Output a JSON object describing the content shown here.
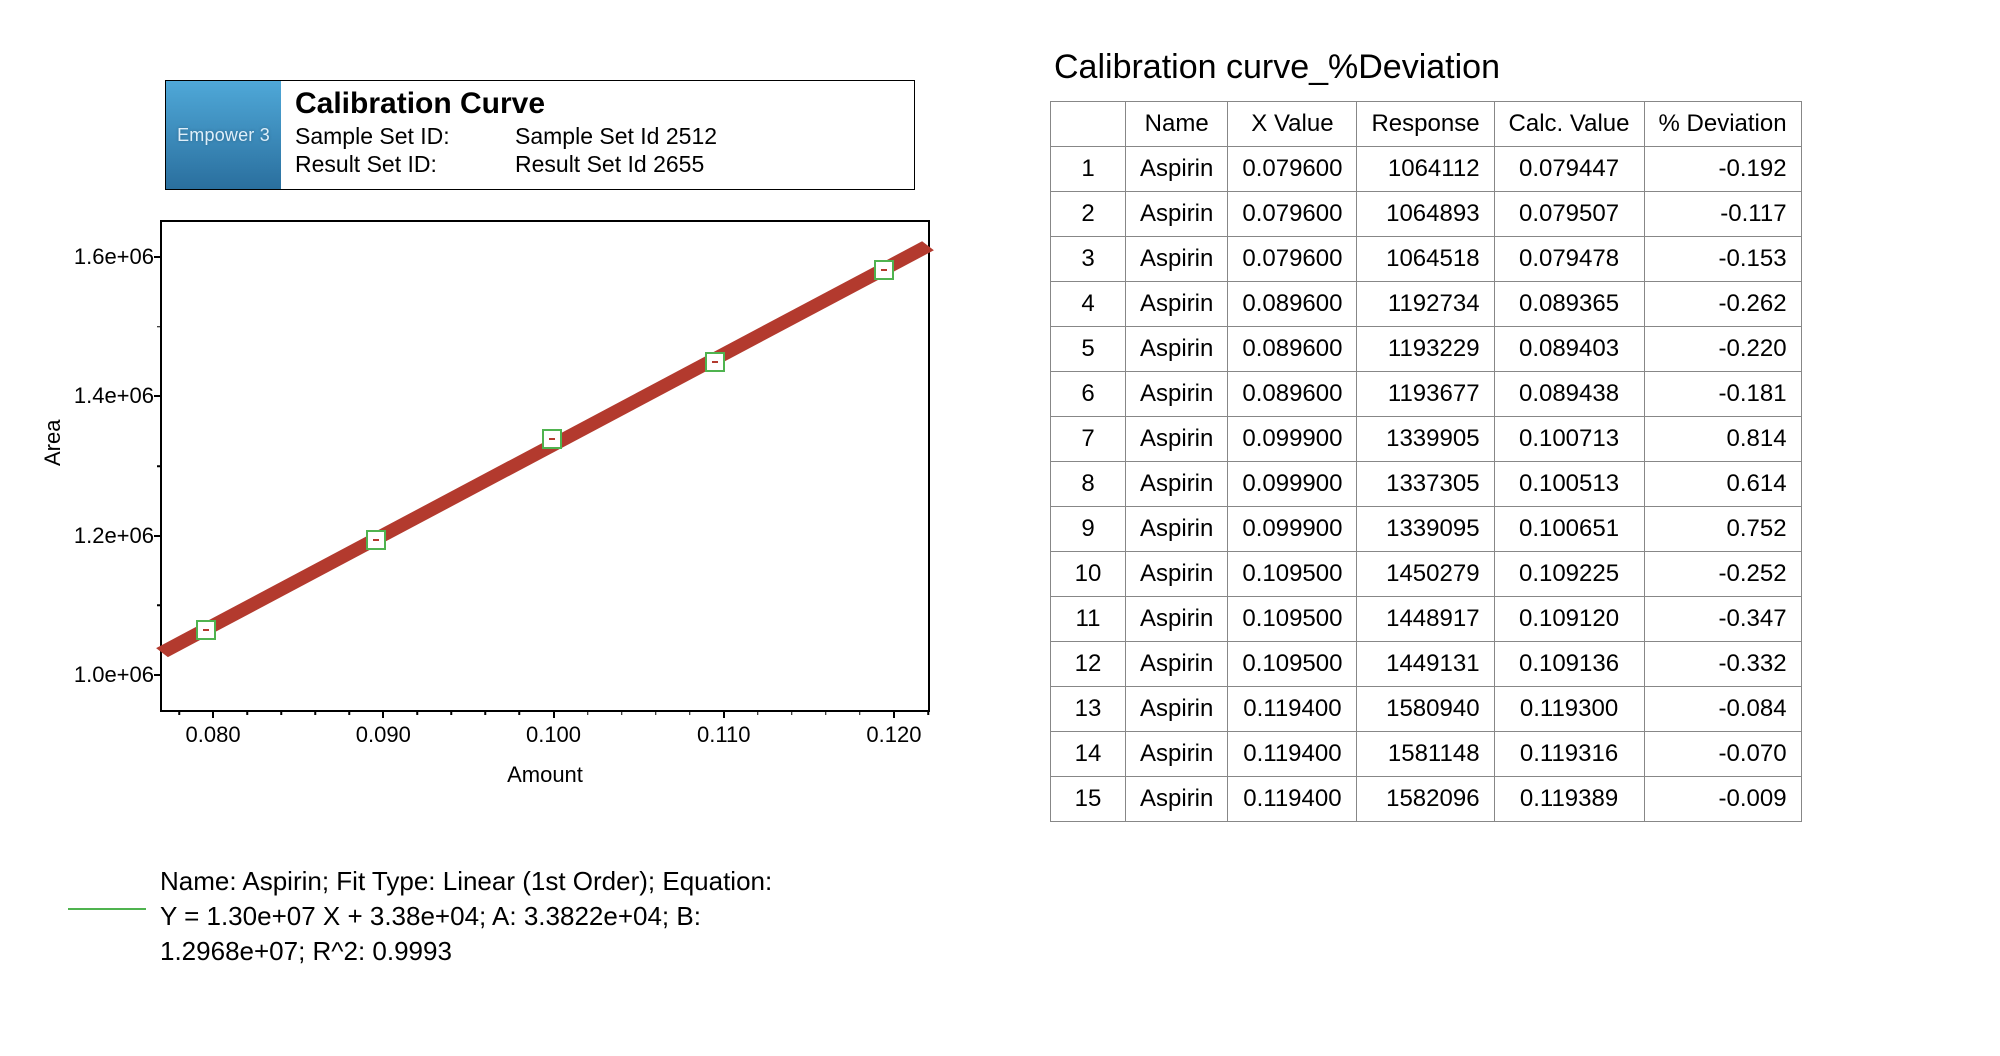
{
  "header": {
    "logo_text": "Empower 3",
    "title": "Calibration Curve",
    "sample_set_label": "Sample Set ID:",
    "sample_set_value": "Sample Set Id 2512",
    "result_set_label": "Result Set ID:",
    "result_set_value": "Result Set Id 2655"
  },
  "chart_data": {
    "type": "scatter",
    "title": "",
    "xlabel": "Amount",
    "ylabel": "Area",
    "xlim": [
      0.077,
      0.122
    ],
    "ylim": [
      950000,
      1650000
    ],
    "x_ticks": [
      0.08,
      0.09,
      0.1,
      0.11,
      0.12
    ],
    "x_tick_labels": [
      "0.080",
      "0.090",
      "0.100",
      "0.110",
      "0.120"
    ],
    "y_ticks": [
      1000000,
      1200000,
      1400000,
      1600000
    ],
    "y_tick_labels": [
      "1.0e+06",
      "1.2e+06",
      "1.4e+06",
      "1.6e+06"
    ],
    "series": [
      {
        "name": "Aspirin",
        "x": [
          0.0796,
          0.0896,
          0.0999,
          0.1095,
          0.1194
        ],
        "y": [
          1064500,
          1193200,
          1338800,
          1449400,
          1581400
        ],
        "fit": "linear",
        "fit_slope": 12968000,
        "fit_intercept": 33822
      }
    ],
    "x_minor_interval": 0.002,
    "y_minor_interval": 100000
  },
  "caption": {
    "line1": "Name: Aspirin;   Fit Type: Linear (1st Order); Equation:",
    "line2": "Y = 1.30e+07 X + 3.38e+04;   A: 3.3822e+04;   B:",
    "line3": "1.2968e+07;   R^2: 0.9993"
  },
  "table": {
    "title": "Calibration curve_%Deviation",
    "columns": [
      "",
      "Name",
      "X Value",
      "Response",
      "Calc. Value",
      "% Deviation"
    ],
    "rows": [
      {
        "idx": 1,
        "name": "Aspirin",
        "x": "0.079600",
        "resp": "1064112",
        "calc": "0.079447",
        "dev": "-0.192"
      },
      {
        "idx": 2,
        "name": "Aspirin",
        "x": "0.079600",
        "resp": "1064893",
        "calc": "0.079507",
        "dev": "-0.117"
      },
      {
        "idx": 3,
        "name": "Aspirin",
        "x": "0.079600",
        "resp": "1064518",
        "calc": "0.079478",
        "dev": "-0.153"
      },
      {
        "idx": 4,
        "name": "Aspirin",
        "x": "0.089600",
        "resp": "1192734",
        "calc": "0.089365",
        "dev": "-0.262"
      },
      {
        "idx": 5,
        "name": "Aspirin",
        "x": "0.089600",
        "resp": "1193229",
        "calc": "0.089403",
        "dev": "-0.220"
      },
      {
        "idx": 6,
        "name": "Aspirin",
        "x": "0.089600",
        "resp": "1193677",
        "calc": "0.089438",
        "dev": "-0.181"
      },
      {
        "idx": 7,
        "name": "Aspirin",
        "x": "0.099900",
        "resp": "1339905",
        "calc": "0.100713",
        "dev": "0.814"
      },
      {
        "idx": 8,
        "name": "Aspirin",
        "x": "0.099900",
        "resp": "1337305",
        "calc": "0.100513",
        "dev": "0.614"
      },
      {
        "idx": 9,
        "name": "Aspirin",
        "x": "0.099900",
        "resp": "1339095",
        "calc": "0.100651",
        "dev": "0.752"
      },
      {
        "idx": 10,
        "name": "Aspirin",
        "x": "0.109500",
        "resp": "1450279",
        "calc": "0.109225",
        "dev": "-0.252"
      },
      {
        "idx": 11,
        "name": "Aspirin",
        "x": "0.109500",
        "resp": "1448917",
        "calc": "0.109120",
        "dev": "-0.347"
      },
      {
        "idx": 12,
        "name": "Aspirin",
        "x": "0.109500",
        "resp": "1449131",
        "calc": "0.109136",
        "dev": "-0.332"
      },
      {
        "idx": 13,
        "name": "Aspirin",
        "x": "0.119400",
        "resp": "1580940",
        "calc": "0.119300",
        "dev": "-0.084"
      },
      {
        "idx": 14,
        "name": "Aspirin",
        "x": "0.119400",
        "resp": "1581148",
        "calc": "0.119316",
        "dev": "-0.070"
      },
      {
        "idx": 15,
        "name": "Aspirin",
        "x": "0.119400",
        "resp": "1582096",
        "calc": "0.119389",
        "dev": "-0.009"
      }
    ]
  }
}
